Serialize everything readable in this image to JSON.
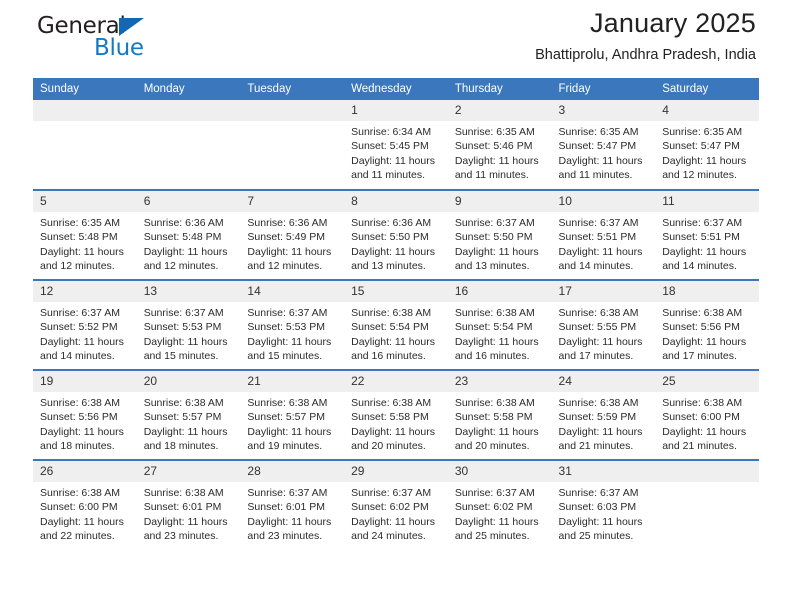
{
  "brand": {
    "name_top": "General",
    "name_bottom": "Blue",
    "accent_color": "#1479c4",
    "triangle_color": "#1268b3"
  },
  "header": {
    "title": "January 2025",
    "subtitle": "Bhattiprolu, Andhra Pradesh, India"
  },
  "theme": {
    "header_blue": "#3b77bc",
    "daynum_band": "#efefef",
    "text": "#222222"
  },
  "weekday_headers": [
    "Sunday",
    "Monday",
    "Tuesday",
    "Wednesday",
    "Thursday",
    "Friday",
    "Saturday"
  ],
  "weeks": [
    [
      {
        "day": "",
        "empty": true
      },
      {
        "day": "",
        "empty": true
      },
      {
        "day": "",
        "empty": true
      },
      {
        "day": "1",
        "sunrise": "Sunrise: 6:34 AM",
        "sunset": "Sunset: 5:45 PM",
        "daylight": "Daylight: 11 hours and 11 minutes."
      },
      {
        "day": "2",
        "sunrise": "Sunrise: 6:35 AM",
        "sunset": "Sunset: 5:46 PM",
        "daylight": "Daylight: 11 hours and 11 minutes."
      },
      {
        "day": "3",
        "sunrise": "Sunrise: 6:35 AM",
        "sunset": "Sunset: 5:47 PM",
        "daylight": "Daylight: 11 hours and 11 minutes."
      },
      {
        "day": "4",
        "sunrise": "Sunrise: 6:35 AM",
        "sunset": "Sunset: 5:47 PM",
        "daylight": "Daylight: 11 hours and 12 minutes."
      }
    ],
    [
      {
        "day": "5",
        "sunrise": "Sunrise: 6:35 AM",
        "sunset": "Sunset: 5:48 PM",
        "daylight": "Daylight: 11 hours and 12 minutes."
      },
      {
        "day": "6",
        "sunrise": "Sunrise: 6:36 AM",
        "sunset": "Sunset: 5:48 PM",
        "daylight": "Daylight: 11 hours and 12 minutes."
      },
      {
        "day": "7",
        "sunrise": "Sunrise: 6:36 AM",
        "sunset": "Sunset: 5:49 PM",
        "daylight": "Daylight: 11 hours and 12 minutes."
      },
      {
        "day": "8",
        "sunrise": "Sunrise: 6:36 AM",
        "sunset": "Sunset: 5:50 PM",
        "daylight": "Daylight: 11 hours and 13 minutes."
      },
      {
        "day": "9",
        "sunrise": "Sunrise: 6:37 AM",
        "sunset": "Sunset: 5:50 PM",
        "daylight": "Daylight: 11 hours and 13 minutes."
      },
      {
        "day": "10",
        "sunrise": "Sunrise: 6:37 AM",
        "sunset": "Sunset: 5:51 PM",
        "daylight": "Daylight: 11 hours and 14 minutes."
      },
      {
        "day": "11",
        "sunrise": "Sunrise: 6:37 AM",
        "sunset": "Sunset: 5:51 PM",
        "daylight": "Daylight: 11 hours and 14 minutes."
      }
    ],
    [
      {
        "day": "12",
        "sunrise": "Sunrise: 6:37 AM",
        "sunset": "Sunset: 5:52 PM",
        "daylight": "Daylight: 11 hours and 14 minutes."
      },
      {
        "day": "13",
        "sunrise": "Sunrise: 6:37 AM",
        "sunset": "Sunset: 5:53 PM",
        "daylight": "Daylight: 11 hours and 15 minutes."
      },
      {
        "day": "14",
        "sunrise": "Sunrise: 6:37 AM",
        "sunset": "Sunset: 5:53 PM",
        "daylight": "Daylight: 11 hours and 15 minutes."
      },
      {
        "day": "15",
        "sunrise": "Sunrise: 6:38 AM",
        "sunset": "Sunset: 5:54 PM",
        "daylight": "Daylight: 11 hours and 16 minutes."
      },
      {
        "day": "16",
        "sunrise": "Sunrise: 6:38 AM",
        "sunset": "Sunset: 5:54 PM",
        "daylight": "Daylight: 11 hours and 16 minutes."
      },
      {
        "day": "17",
        "sunrise": "Sunrise: 6:38 AM",
        "sunset": "Sunset: 5:55 PM",
        "daylight": "Daylight: 11 hours and 17 minutes."
      },
      {
        "day": "18",
        "sunrise": "Sunrise: 6:38 AM",
        "sunset": "Sunset: 5:56 PM",
        "daylight": "Daylight: 11 hours and 17 minutes."
      }
    ],
    [
      {
        "day": "19",
        "sunrise": "Sunrise: 6:38 AM",
        "sunset": "Sunset: 5:56 PM",
        "daylight": "Daylight: 11 hours and 18 minutes."
      },
      {
        "day": "20",
        "sunrise": "Sunrise: 6:38 AM",
        "sunset": "Sunset: 5:57 PM",
        "daylight": "Daylight: 11 hours and 18 minutes."
      },
      {
        "day": "21",
        "sunrise": "Sunrise: 6:38 AM",
        "sunset": "Sunset: 5:57 PM",
        "daylight": "Daylight: 11 hours and 19 minutes."
      },
      {
        "day": "22",
        "sunrise": "Sunrise: 6:38 AM",
        "sunset": "Sunset: 5:58 PM",
        "daylight": "Daylight: 11 hours and 20 minutes."
      },
      {
        "day": "23",
        "sunrise": "Sunrise: 6:38 AM",
        "sunset": "Sunset: 5:58 PM",
        "daylight": "Daylight: 11 hours and 20 minutes."
      },
      {
        "day": "24",
        "sunrise": "Sunrise: 6:38 AM",
        "sunset": "Sunset: 5:59 PM",
        "daylight": "Daylight: 11 hours and 21 minutes."
      },
      {
        "day": "25",
        "sunrise": "Sunrise: 6:38 AM",
        "sunset": "Sunset: 6:00 PM",
        "daylight": "Daylight: 11 hours and 21 minutes."
      }
    ],
    [
      {
        "day": "26",
        "sunrise": "Sunrise: 6:38 AM",
        "sunset": "Sunset: 6:00 PM",
        "daylight": "Daylight: 11 hours and 22 minutes."
      },
      {
        "day": "27",
        "sunrise": "Sunrise: 6:38 AM",
        "sunset": "Sunset: 6:01 PM",
        "daylight": "Daylight: 11 hours and 23 minutes."
      },
      {
        "day": "28",
        "sunrise": "Sunrise: 6:37 AM",
        "sunset": "Sunset: 6:01 PM",
        "daylight": "Daylight: 11 hours and 23 minutes."
      },
      {
        "day": "29",
        "sunrise": "Sunrise: 6:37 AM",
        "sunset": "Sunset: 6:02 PM",
        "daylight": "Daylight: 11 hours and 24 minutes."
      },
      {
        "day": "30",
        "sunrise": "Sunrise: 6:37 AM",
        "sunset": "Sunset: 6:02 PM",
        "daylight": "Daylight: 11 hours and 25 minutes."
      },
      {
        "day": "31",
        "sunrise": "Sunrise: 6:37 AM",
        "sunset": "Sunset: 6:03 PM",
        "daylight": "Daylight: 11 hours and 25 minutes."
      },
      {
        "day": "",
        "empty": true
      }
    ]
  ]
}
